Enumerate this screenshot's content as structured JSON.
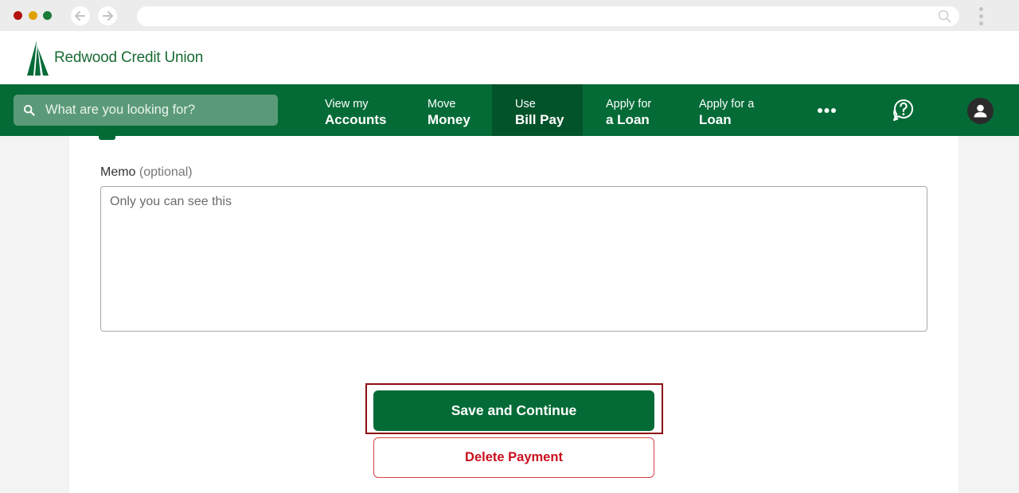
{
  "brand": {
    "name": "Redwood Credit Union",
    "primary_color": "#046b37",
    "active_nav_color": "#03532a",
    "danger_color": "#c8101e"
  },
  "search": {
    "placeholder": "What are you looking for?"
  },
  "nav": {
    "items": [
      {
        "line1": "View my",
        "line2": "Accounts"
      },
      {
        "line1": "Move",
        "line2": "Money"
      },
      {
        "line1": "Use",
        "line2": "Bill Pay"
      },
      {
        "line1": "Apply for",
        "line2": "a Loan"
      },
      {
        "line1": "Apply for a",
        "line2": "Loan"
      }
    ],
    "active_index": 2,
    "more_icon": "more-horizontal-icon",
    "help_icon": "help-chat-icon",
    "profile_icon": "user-avatar-icon"
  },
  "form": {
    "memo_label": "Memo",
    "memo_optional": "(optional)",
    "memo_placeholder": "Only you can see this",
    "memo_value": ""
  },
  "actions": {
    "save_label": "Save and Continue",
    "delete_label": "Delete Payment"
  }
}
